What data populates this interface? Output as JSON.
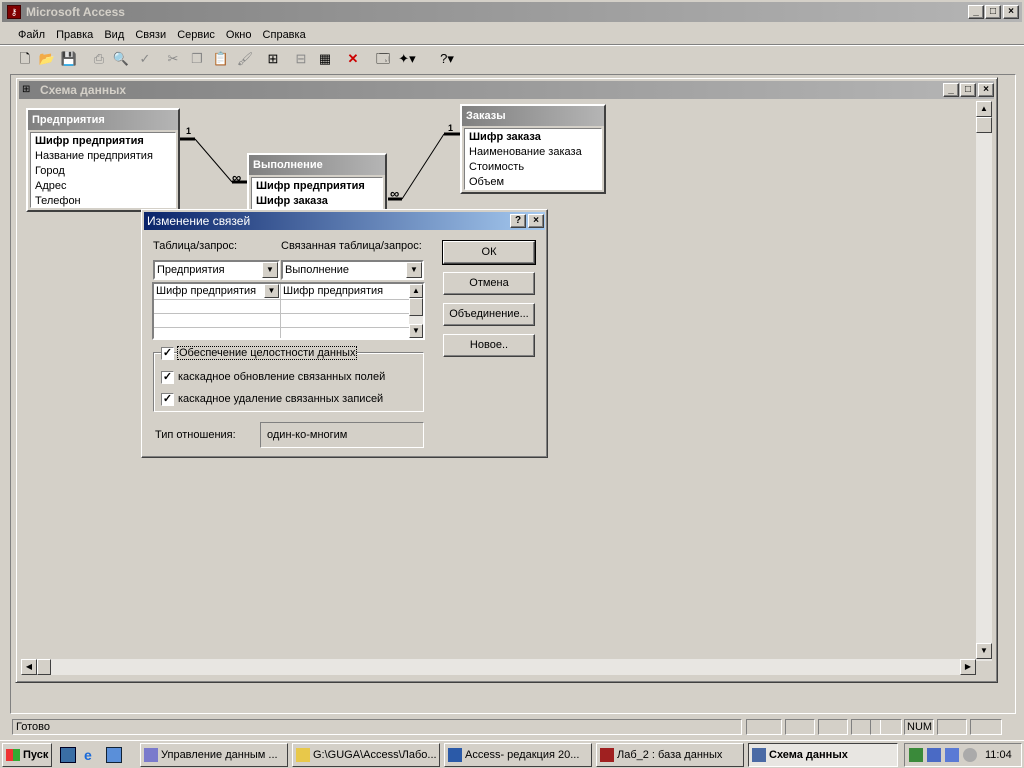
{
  "app": {
    "title": "Microsoft Access"
  },
  "menu": [
    "Файл",
    "Правка",
    "Вид",
    "Связи",
    "Сервис",
    "Окно",
    "Справка"
  ],
  "schema_window": {
    "title": "Схема данных"
  },
  "tables": {
    "t1": {
      "title": "Предприятия",
      "fields": [
        "Шифр предприятия",
        "Название предприятия",
        "Город",
        "Адрес",
        "Телефон"
      ]
    },
    "t2": {
      "title": "Выполнение",
      "fields": [
        "Шифр предприятия",
        "Шифр заказа"
      ]
    },
    "t3": {
      "title": "Заказы",
      "fields": [
        "Шифр заказа",
        "Наименование заказа",
        "Стоимость",
        "Объем"
      ]
    }
  },
  "rel": {
    "one": "1",
    "many": "∞"
  },
  "dialog": {
    "title": "Изменение связей",
    "table_label": "Таблица/запрос:",
    "related_label": "Связанная таблица/запрос:",
    "table_value": "Предприятия",
    "related_value": "Выполнение",
    "field_left": "Шифр предприятия",
    "field_right": "Шифр предприятия",
    "integrity": "Обеспечение целостности данных",
    "cascade_update": "каскадное обновление связанных полей",
    "cascade_delete": "каскадное удаление связанных записей",
    "rel_type_label": "Тип отношения:",
    "rel_type_value": "один-ко-многим",
    "ok": "ОК",
    "cancel": "Отмена",
    "join": "Объединение...",
    "new": "Новое.."
  },
  "status": {
    "text": "Готово",
    "num": "NUM"
  },
  "taskbar": {
    "start": "Пуск",
    "items": [
      "Управление данным ...",
      "G:\\GUGA\\Access\\Лабо...",
      "Access- редакция 20...",
      "Лаб_2 : база данных",
      "Схема данных"
    ],
    "clock": "11:04"
  },
  "colors": {
    "title_active": "#0a246a",
    "title_inactive": "#808080",
    "face": "#d4d0c8"
  }
}
